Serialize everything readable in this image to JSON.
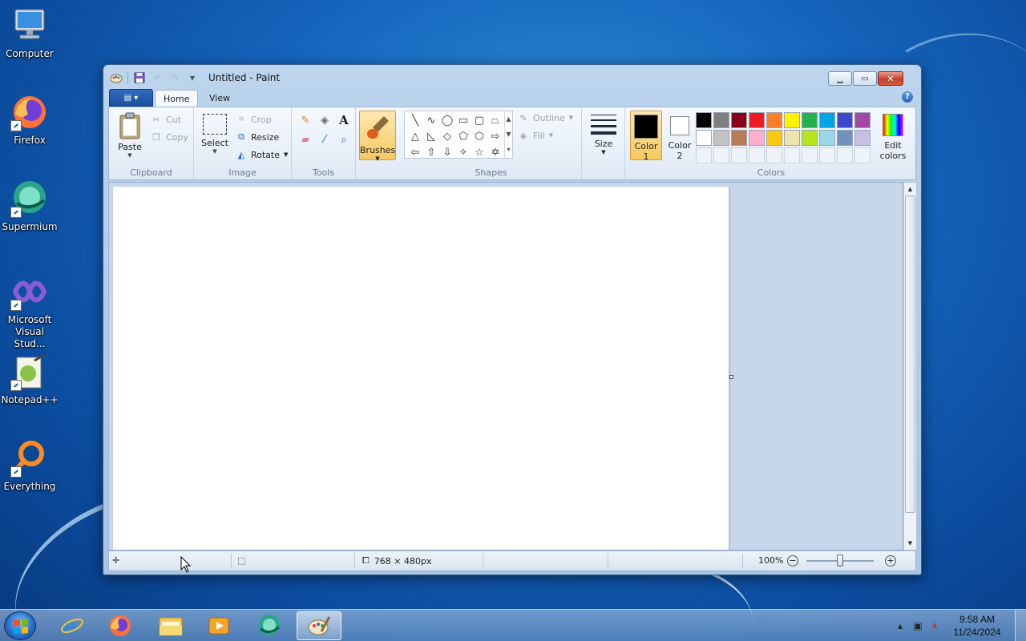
{
  "desktop": {
    "icons": [
      {
        "label": "Computer"
      },
      {
        "label": "Firefox"
      },
      {
        "label": "Supermium"
      },
      {
        "label": "Microsoft Visual Stud..."
      },
      {
        "label": "Notepad++"
      },
      {
        "label": "Everything"
      }
    ]
  },
  "window": {
    "title": "Untitled - Paint",
    "controls": {
      "minimize": "▁",
      "maximize": "▭",
      "close": "✕"
    }
  },
  "ribbon": {
    "tabs": [
      {
        "label": "Home",
        "active": true
      },
      {
        "label": "View",
        "active": false
      }
    ],
    "help": "?",
    "groups": {
      "clipboard": {
        "label": "Clipboard",
        "paste": "Paste",
        "cut": "Cut",
        "copy": "Copy"
      },
      "image": {
        "label": "Image",
        "select": "Select",
        "crop": "Crop",
        "resize": "Resize",
        "rotate": "Rotate"
      },
      "tools": {
        "label": "Tools"
      },
      "brushes": {
        "label": "Brushes"
      },
      "shapes": {
        "label": "Shapes",
        "outline": "Outline",
        "fill": "Fill"
      },
      "size": {
        "label": "Size"
      },
      "colors": {
        "label": "Colors",
        "color1_label": "Color\n1",
        "color1_line1": "Color",
        "color1_line2": "1",
        "color2_line1": "Color",
        "color2_line2": "2",
        "edit_line1": "Edit",
        "edit_line2": "colors",
        "color1": "#000000",
        "color2": "#ffffff",
        "palette": [
          "#000000",
          "#7f7f7f",
          "#880015",
          "#ed1c24",
          "#ff7f27",
          "#fff200",
          "#22b14c",
          "#00a2e8",
          "#3f48cc",
          "#a349a4",
          "#ffffff",
          "#c3c3c3",
          "#b97a57",
          "#ffaec9",
          "#ffc90e",
          "#efe4b0",
          "#b5e61d",
          "#99d9ea",
          "#7092be",
          "#c8bfe7"
        ]
      }
    }
  },
  "statusbar": {
    "dimensions": "768 × 480px",
    "zoom": "100%",
    "zoom_level_fraction": 0.5
  },
  "taskbar": {
    "time": "9:58 AM",
    "date": "11/24/2024"
  }
}
